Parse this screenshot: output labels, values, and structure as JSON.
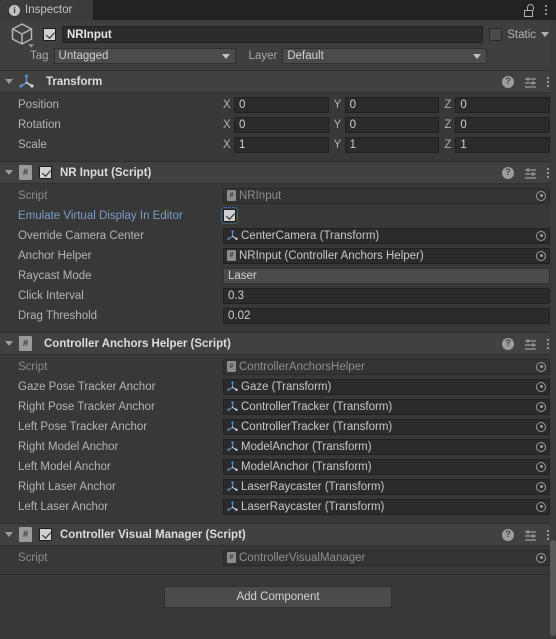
{
  "window": {
    "tab_label": "Inspector",
    "tab_icon": "info-icon",
    "lock_icon": "unlocked-padlock-icon",
    "menu_icon": "kebab-menu-icon"
  },
  "gameobject": {
    "icon": "cube-icon",
    "enabled": true,
    "name": "NRInput",
    "static_label": "Static",
    "static_checked": false,
    "tag_label": "Tag",
    "tag_value": "Untagged",
    "layer_label": "Layer",
    "layer_value": "Default"
  },
  "components": [
    {
      "title": "Transform",
      "icon": "transform-gizmo-icon",
      "has_enable_checkbox": false,
      "expanded": true,
      "vectors": [
        {
          "label": "Position",
          "x": "0",
          "y": "0",
          "z": "0"
        },
        {
          "label": "Rotation",
          "x": "0",
          "y": "0",
          "z": "0"
        },
        {
          "label": "Scale",
          "x": "1",
          "y": "1",
          "z": "1"
        }
      ]
    },
    {
      "title": "NR Input (Script)",
      "icon": "script-icon",
      "has_enable_checkbox": true,
      "enabled": true,
      "expanded": true,
      "rows": [
        {
          "label": "Script",
          "label_style": "dim",
          "type": "object",
          "value": "NRInput",
          "icon": "script-asset-icon",
          "disabled": true
        },
        {
          "label": "Emulate Virtual Display In Editor",
          "label_style": "blue",
          "type": "checkbox",
          "checked": true,
          "focused": true
        },
        {
          "label": "Override Camera Center",
          "type": "object",
          "value": "CenterCamera (Transform)",
          "icon": "transform-gizmo-icon"
        },
        {
          "label": "Anchor Helper",
          "type": "object",
          "value": "NRInput (Controller Anchors Helper)",
          "icon": "script-asset-icon"
        },
        {
          "label": "Raycast Mode",
          "type": "enum",
          "value": "Laser"
        },
        {
          "label": "Click Interval",
          "type": "text",
          "value": "0.3"
        },
        {
          "label": "Drag Threshold",
          "type": "text",
          "value": "0.02"
        }
      ]
    },
    {
      "title": "Controller Anchors Helper (Script)",
      "icon": "script-icon",
      "has_enable_checkbox": false,
      "expanded": true,
      "rows": [
        {
          "label": "Script",
          "label_style": "dim",
          "type": "object",
          "value": "ControllerAnchorsHelper",
          "icon": "script-asset-icon",
          "disabled": true
        },
        {
          "label": "Gaze Pose Tracker Anchor",
          "type": "object",
          "value": "Gaze (Transform)",
          "icon": "transform-gizmo-icon"
        },
        {
          "label": "Right Pose Tracker Anchor",
          "type": "object",
          "value": "ControllerTracker (Transform)",
          "icon": "transform-gizmo-icon"
        },
        {
          "label": "Left Pose Tracker Anchor",
          "type": "object",
          "value": "ControllerTracker (Transform)",
          "icon": "transform-gizmo-icon"
        },
        {
          "label": "Right Model Anchor",
          "type": "object",
          "value": "ModelAnchor (Transform)",
          "icon": "transform-gizmo-icon"
        },
        {
          "label": "Left Model Anchor",
          "type": "object",
          "value": "ModelAnchor (Transform)",
          "icon": "transform-gizmo-icon"
        },
        {
          "label": "Right Laser Anchor",
          "type": "object",
          "value": "LaserRaycaster (Transform)",
          "icon": "transform-gizmo-icon"
        },
        {
          "label": "Left Laser Anchor",
          "type": "object",
          "value": "LaserRaycaster (Transform)",
          "icon": "transform-gizmo-icon"
        }
      ]
    },
    {
      "title": "Controller Visual Manager (Script)",
      "icon": "script-icon",
      "has_enable_checkbox": true,
      "enabled": true,
      "expanded": true,
      "rows": [
        {
          "label": "Script",
          "label_style": "dim",
          "type": "object",
          "value": "ControllerVisualManager",
          "icon": "script-asset-icon",
          "disabled": true
        }
      ]
    }
  ],
  "header_icons": {
    "help": "?",
    "help_name": "help-icon",
    "preset": "preset-icon",
    "menu": "kebab-menu-icon"
  },
  "footer": {
    "add_component_label": "Add Component"
  },
  "colors": {
    "background": "#383838",
    "component_header": "#414141",
    "field": "#2b2b2b",
    "dropdown": "#4b4b4b",
    "text": "#b4b4b4",
    "override_blue": "#7b9cc6",
    "transform_icon_blue": "#4a7fb5"
  }
}
